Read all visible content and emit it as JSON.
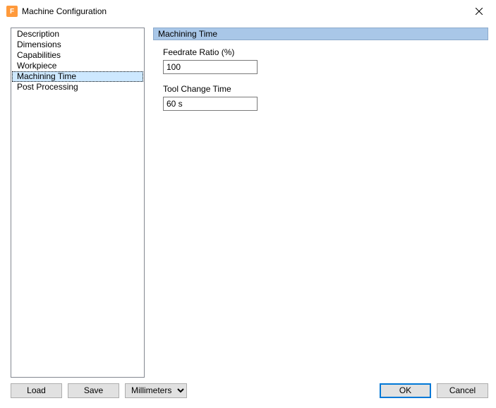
{
  "window": {
    "title": "Machine Configuration",
    "icon_letter": "F"
  },
  "nav": {
    "items": [
      {
        "label": "Description"
      },
      {
        "label": "Dimensions"
      },
      {
        "label": "Capabilities"
      },
      {
        "label": "Workpiece"
      },
      {
        "label": "Machining Time",
        "selected": true
      },
      {
        "label": "Post Processing"
      }
    ]
  },
  "section": {
    "header": "Machining Time",
    "feedrate_label": "Feedrate Ratio (%)",
    "feedrate_value": "100",
    "toolchange_label": "Tool Change Time",
    "toolchange_value": "60 s"
  },
  "footer": {
    "load": "Load",
    "save": "Save",
    "units_selected": "Millimeters",
    "ok": "OK",
    "cancel": "Cancel"
  }
}
